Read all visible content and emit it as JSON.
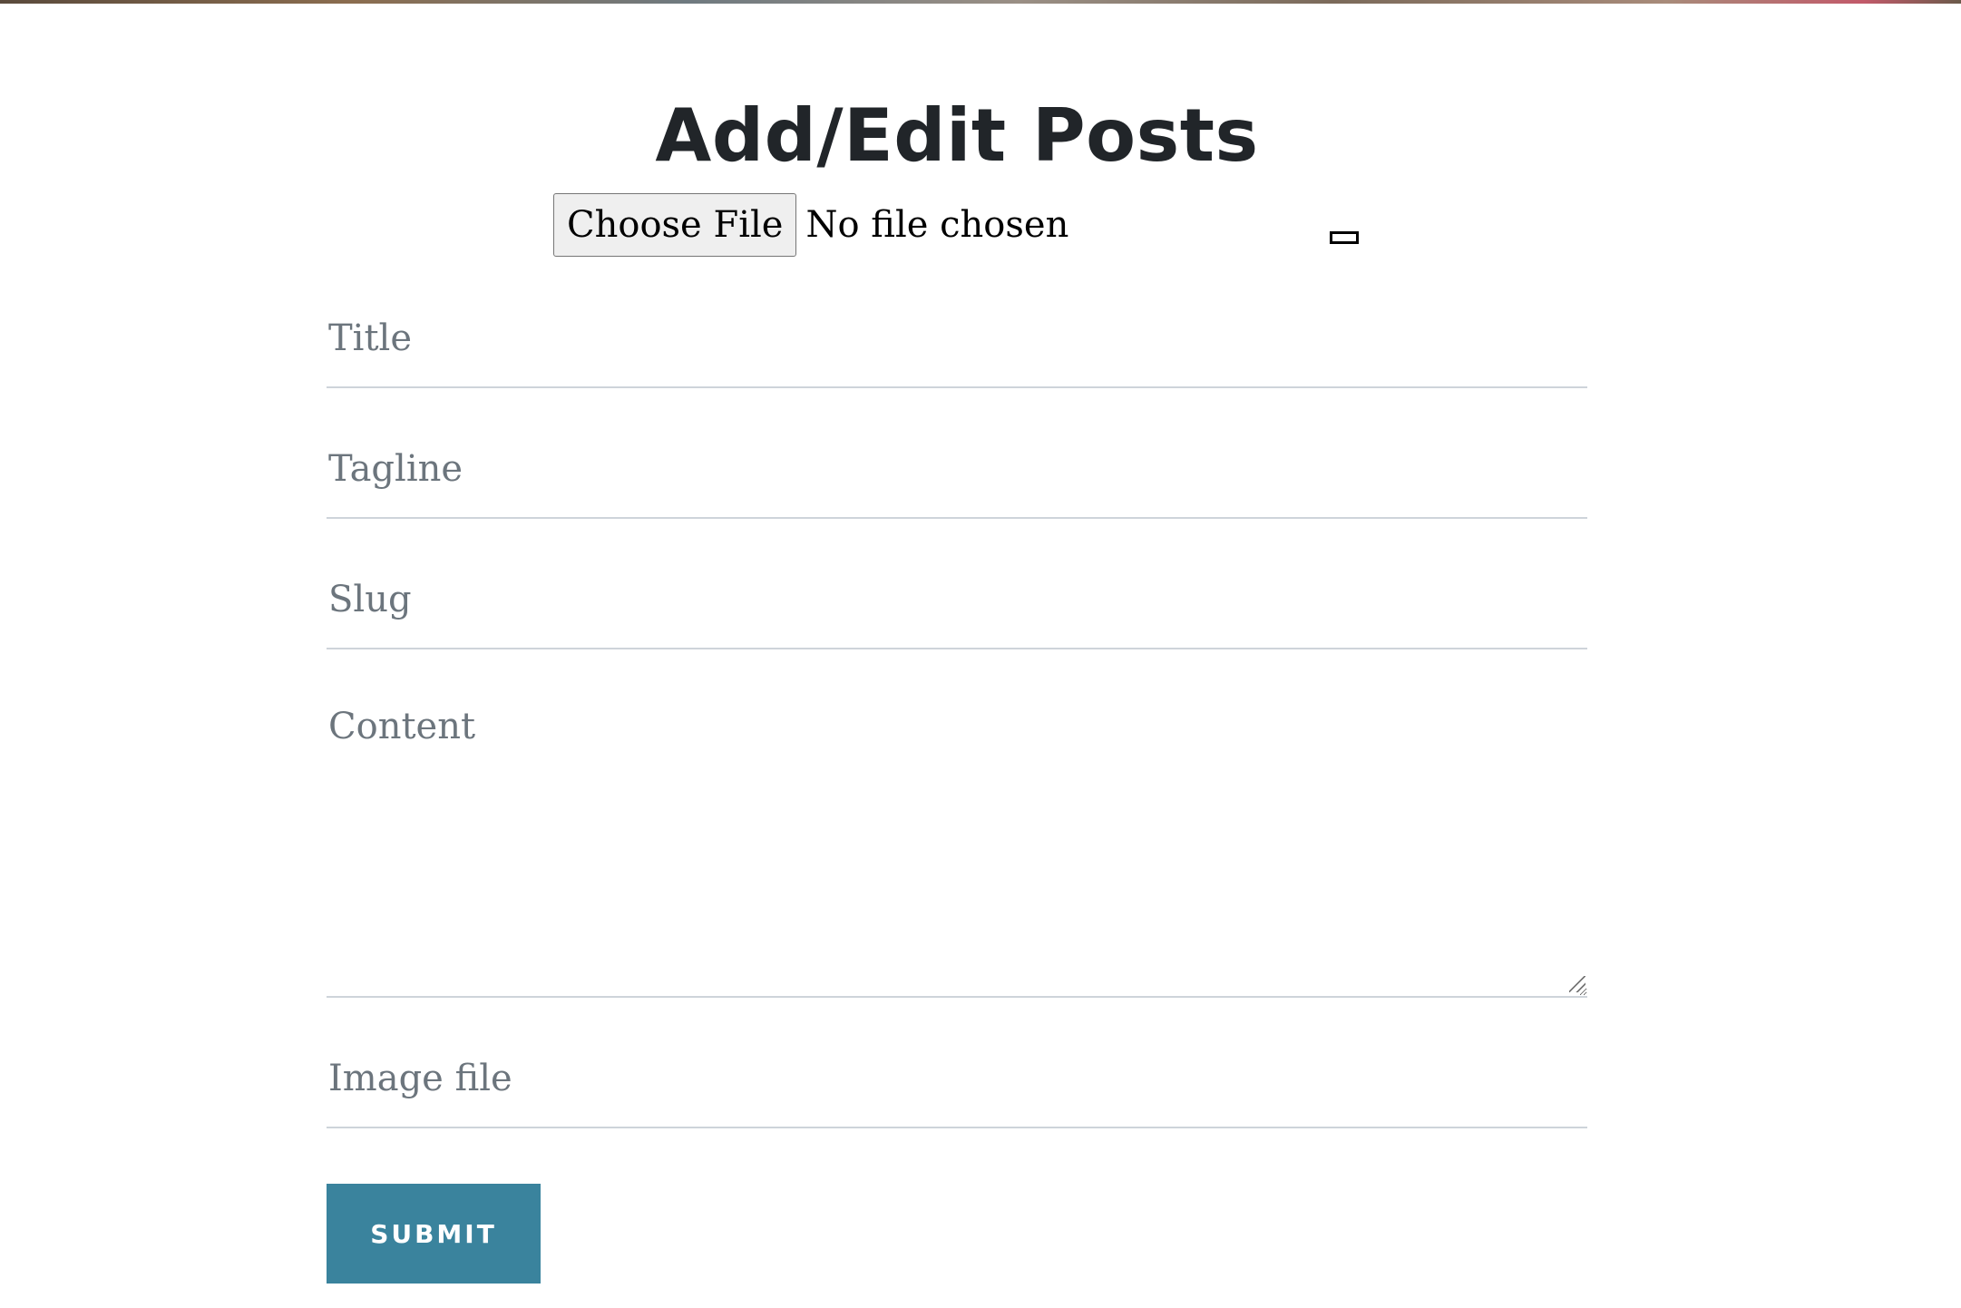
{
  "page": {
    "title": "Add/Edit Posts"
  },
  "file_picker": {
    "button_label": "Choose File",
    "status": "No file chosen"
  },
  "form": {
    "fields": {
      "title": {
        "placeholder": "Title",
        "value": ""
      },
      "tagline": {
        "placeholder": "Tagline",
        "value": ""
      },
      "slug": {
        "placeholder": "Slug",
        "value": ""
      },
      "content": {
        "placeholder": "Content",
        "value": ""
      },
      "image_file": {
        "placeholder": "Image file",
        "value": ""
      }
    },
    "submit_label": "SUBMIT"
  },
  "colors": {
    "text": "#212529",
    "placeholder": "#6c757d",
    "underline": "#ced4da",
    "submit_bg": "#3a839d",
    "submit_text": "#ffffff"
  }
}
